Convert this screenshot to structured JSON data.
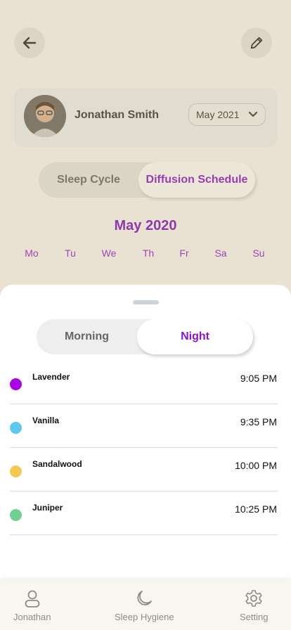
{
  "header": {
    "back_icon": "arrow-left-icon",
    "edit_icon": "pencil-icon"
  },
  "profile": {
    "name": "Jonathan Smith",
    "month_selected": "May 2021"
  },
  "top_tabs": {
    "left": "Sleep Cycle",
    "right": "Diffusion Schedule",
    "active": "Diffusion Schedule"
  },
  "calendar": {
    "title": "May 2020",
    "weekdays": [
      "Mo",
      "Tu",
      "We",
      "Th",
      "Fr",
      "Sa",
      "Su"
    ]
  },
  "sheet": {
    "tabs": {
      "left": "Morning",
      "right": "Night",
      "active": "Night"
    },
    "items": [
      {
        "name": "Lavender",
        "time": "9:05 PM",
        "color": "#aa04e5"
      },
      {
        "name": "Vanilla",
        "time": "9:35 PM",
        "color": "#5cc8ee"
      },
      {
        "name": "Sandalwood",
        "time": "10:00 PM",
        "color": "#f5c951"
      },
      {
        "name": "Juniper",
        "time": "10:25 PM",
        "color": "#6fd092"
      }
    ]
  },
  "nav": {
    "items": [
      {
        "label": "Jonathan",
        "icon": "user-icon"
      },
      {
        "label": "Sleep Hygiene",
        "icon": "moon-icon"
      },
      {
        "label": "Setting",
        "icon": "gear-icon"
      }
    ]
  },
  "colors": {
    "accent": "#8a14c7",
    "overlay": "#beaa78"
  }
}
